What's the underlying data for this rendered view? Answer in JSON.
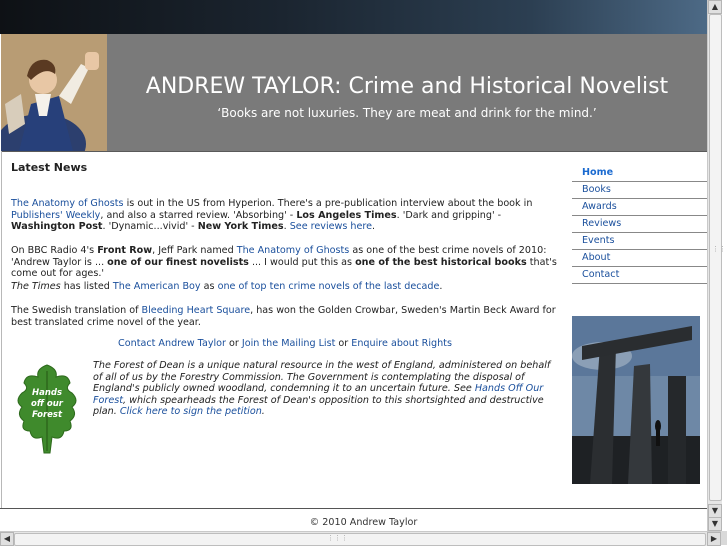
{
  "header": {
    "title": "ANDREW TAYLOR: Crime and Historical Novelist",
    "quote": "‘Books are not luxuries. They are meat and drink for the mind.’"
  },
  "news": {
    "heading": "Latest News",
    "p1": {
      "link1": "The Anatomy of Ghosts",
      "t1": " is out in the US from Hyperion. There's a pre-publication interview about the book in ",
      "link2": "Publishers' Weekly",
      "t2": ", and also a starred review. 'Absorbing' - ",
      "b1": "Los Angeles Times",
      "t3": ". 'Dark and gripping' - ",
      "b2": "Washington Post",
      "t4": ". 'Dynamic...vivid' - ",
      "b3": "New York Times",
      "t5": ". ",
      "link3": "See reviews here",
      "t6": "."
    },
    "p2": {
      "t1": "On BBC Radio 4's ",
      "b1": "Front Row",
      "t2": ", Jeff Park named ",
      "link1": "The Anatomy of Ghosts",
      "t3": " as one of the best crime novels of 2010: 'Andrew Taylor is ... ",
      "b2": "one of our finest novelists",
      "t4": " ... I would put this as ",
      "b3": "one of the best historical books",
      "t5": " that's come out for ages.'"
    },
    "p3": {
      "i1": "The Times",
      "t1": " has listed ",
      "link1": "The American Boy",
      "t2": " as ",
      "link2": "one of top ten crime novels of the last decade",
      "t3": "."
    },
    "p4": {
      "t1": "The Swedish translation of ",
      "link1": "Bleeding Heart Square",
      "t2": ", has won the Golden Crowbar, Sweden's Martin Beck Award for best translated crime novel of the year."
    },
    "contact": {
      "link1": "Contact Andrew Taylor",
      "or1": " or ",
      "link2": "Join the Mailing List",
      "or2": " or ",
      "link3": "Enquire about Rights"
    },
    "forest": {
      "badge": [
        "Hands",
        "off our",
        "Forest"
      ],
      "t1": "The Forest of Dean is a unique natural resource in the west of England, administered on behalf of all of us by the Forestry Commission. The Government is contemplating the disposal of England's publicly owned woodland, condemning it to an uncertain future. See ",
      "link1": "Hands Off Our Forest",
      "t2": ", which spearheads the Forest of Dean's opposition to this shortsighted and destructive plan. ",
      "link2": "Click here to sign the petition",
      "t3": "."
    }
  },
  "nav": {
    "items": [
      "Home",
      "Books",
      "Awards",
      "Reviews",
      "Events",
      "About",
      "Contact"
    ]
  },
  "footer": {
    "text": "© 2010 Andrew Taylor"
  }
}
